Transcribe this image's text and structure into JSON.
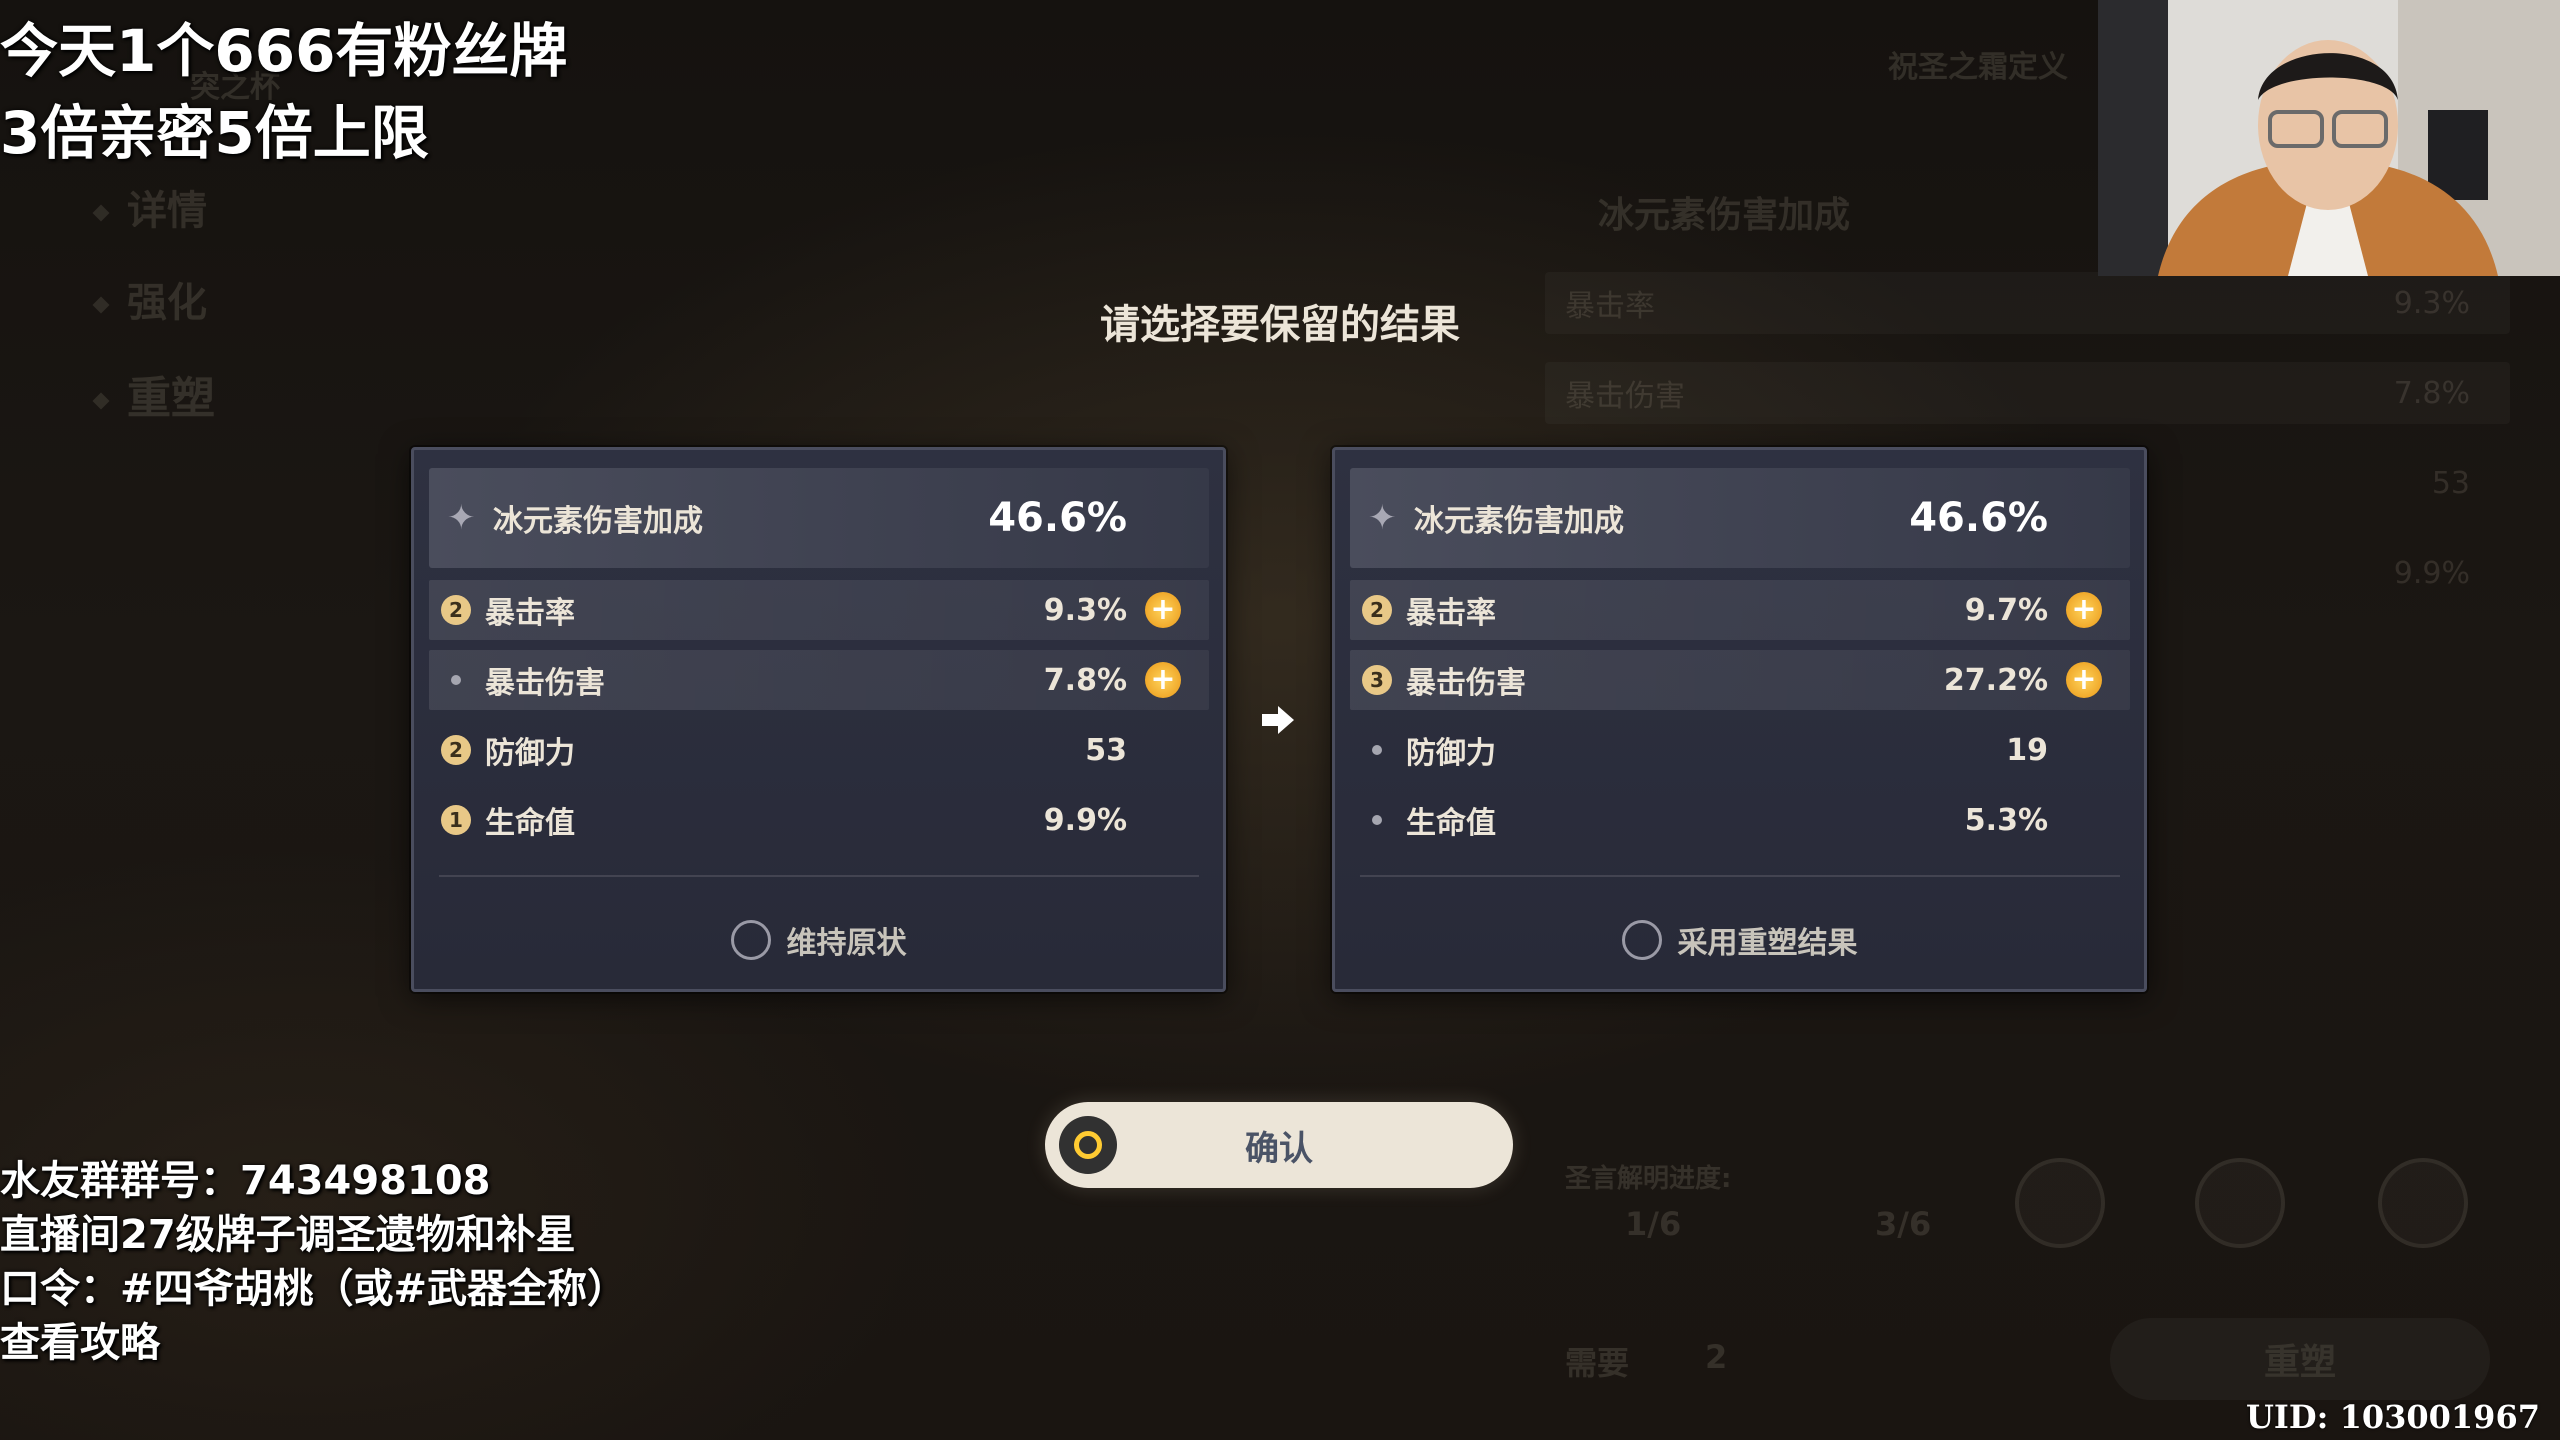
{
  "stream_overlay": {
    "promo_line1": "今天1个666有粉丝牌",
    "promo_line2": "3倍亲密5倍上限",
    "group_line": "水友群群号：743498108",
    "info_line": "直播间27级牌子调圣遗物和补星",
    "command_line": "口令：#四爷胡桃（或#武器全称）",
    "guide_line": "查看攻略"
  },
  "background_ui": {
    "artifact_name": "突之杯",
    "set_tag": "祝圣之霜定义",
    "menu": [
      "详情",
      "强化",
      "重塑"
    ],
    "main_stat": "冰元素伤害加成",
    "stats": [
      {
        "label": "暴击率",
        "value": "9.3%"
      },
      {
        "label": "暴击伤害",
        "value": "7.8%"
      },
      {
        "label": "",
        "value": "53"
      },
      {
        "label": "",
        "value": "9.9%"
      }
    ],
    "progress_label": "圣言解明进度:",
    "progress_from": "1/6",
    "progress_to": "3/6",
    "need_label": "需要",
    "need_count": "2",
    "reshape_button": "重塑"
  },
  "dialog": {
    "title": "请选择要保留的结果",
    "left_card": {
      "main_label": "冰元素伤害加成",
      "main_value": "46.6%",
      "substats": [
        {
          "badge": "2",
          "label": "暴击率",
          "value": "9.3%",
          "highlight": true,
          "plus": true
        },
        {
          "badge": "",
          "label": "暴击伤害",
          "value": "7.8%",
          "highlight": true,
          "plus": true
        },
        {
          "badge": "2",
          "label": "防御力",
          "value": "53",
          "highlight": false,
          "plus": false
        },
        {
          "badge": "1",
          "label": "生命值",
          "value": "9.9%",
          "highlight": false,
          "plus": false
        }
      ],
      "option_label": "维持原状"
    },
    "right_card": {
      "main_label": "冰元素伤害加成",
      "main_value": "46.6%",
      "substats": [
        {
          "badge": "2",
          "label": "暴击率",
          "value": "9.7%",
          "highlight": true,
          "plus": true
        },
        {
          "badge": "3",
          "label": "暴击伤害",
          "value": "27.2%",
          "highlight": true,
          "plus": true
        },
        {
          "badge": "",
          "label": "防御力",
          "value": "19",
          "highlight": false,
          "plus": false
        },
        {
          "badge": "",
          "label": "生命值",
          "value": "5.3%",
          "highlight": false,
          "plus": false
        }
      ],
      "option_label": "采用重塑结果"
    },
    "confirm_label": "确认"
  },
  "uid": "UID: 103001967",
  "colors": {
    "accent_gold": "#e8c887",
    "plus_orange": "#f0a92b",
    "button_bg": "#ece5d8",
    "card_bg": "#2e3141"
  }
}
